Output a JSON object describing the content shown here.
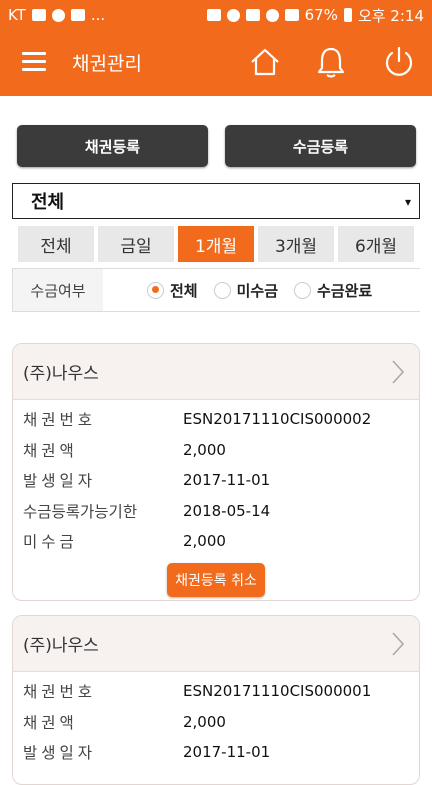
{
  "status_bar": {
    "carrier": "KT",
    "dots": "...",
    "battery": "67%",
    "time": "오후 2:14"
  },
  "header": {
    "title": "채권관리",
    "icons": [
      "menu-icon",
      "home-icon",
      "bell-icon",
      "power-icon"
    ]
  },
  "actions": {
    "register_claim": "채권등록",
    "register_collection": "수금등록"
  },
  "select": {
    "value": "전체",
    "arrow": "▾"
  },
  "periods": [
    {
      "label": "전체",
      "active": false
    },
    {
      "label": "금일",
      "active": false
    },
    {
      "label": "1개월",
      "active": true
    },
    {
      "label": "3개월",
      "active": false
    },
    {
      "label": "6개월",
      "active": false
    }
  ],
  "filter": {
    "label": "수금여부",
    "options": [
      {
        "label": "전체",
        "checked": true
      },
      {
        "label": "미수금",
        "checked": false
      },
      {
        "label": "수금완료",
        "checked": false
      }
    ]
  },
  "cards": [
    {
      "company": "(주)나우스",
      "rows": [
        {
          "label": "채권번호",
          "value": "ESN20171110CIS000002"
        },
        {
          "label": "채권액",
          "value": "2,000"
        },
        {
          "label": "발생일자",
          "value": "2017-11-01"
        },
        {
          "label": "수금등록가능기한",
          "value": "2018-05-14"
        },
        {
          "label": "미수금",
          "value": "2,000"
        }
      ],
      "cancel_label": "채권등록 취소"
    },
    {
      "company": "(주)나우스",
      "rows": [
        {
          "label": "채권번호",
          "value": "ESN20171110CIS000001"
        },
        {
          "label": "채권액",
          "value": "2,000"
        },
        {
          "label": "발생일자",
          "value": "2017-11-01"
        }
      ]
    }
  ],
  "colors": {
    "accent": "#f26b1d",
    "dark_button": "#3b3b3b"
  }
}
